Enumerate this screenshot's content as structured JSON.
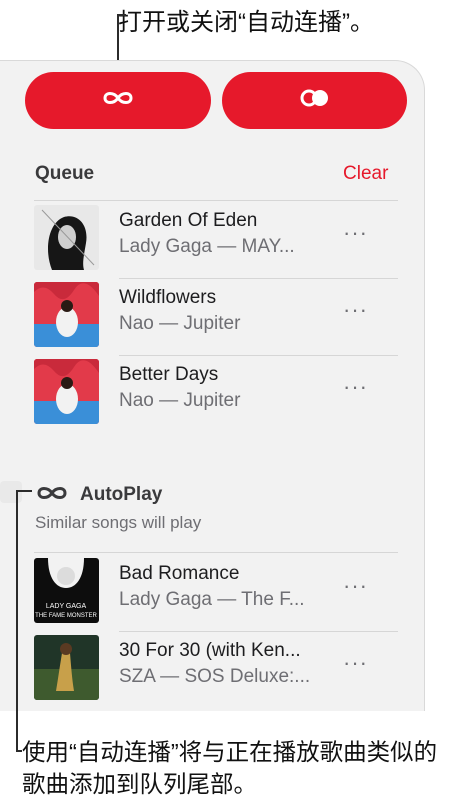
{
  "callouts": {
    "top": "打开或关闭“自动连播”。",
    "bottom": "使用“自动连播”将与正在播放歌曲类似的歌曲添加到队列尾部。"
  },
  "buttons": {
    "autoplay_icon": "infinity-icon",
    "repeat_icon": "toggle-icon",
    "accent": "#e6192b"
  },
  "queue": {
    "title": "Queue",
    "clear_label": "Clear",
    "items": [
      {
        "title": "Garden Of Eden",
        "artist": "Lady Gaga — MAY..."
      },
      {
        "title": "Wildflowers",
        "artist": "Nao — Jupiter"
      },
      {
        "title": "Better Days",
        "artist": "Nao — Jupiter"
      }
    ]
  },
  "autoplay": {
    "title": "AutoPlay",
    "subtitle": "Similar songs will play",
    "items": [
      {
        "title": "Bad Romance",
        "artist": "Lady Gaga — The F...",
        "art_text": "LADY GAGA\nTHE FAME MONSTER"
      },
      {
        "title": "30 For 30 (with Ken...",
        "artist": "SZA — SOS Deluxe:..."
      }
    ]
  },
  "more_label": "···"
}
